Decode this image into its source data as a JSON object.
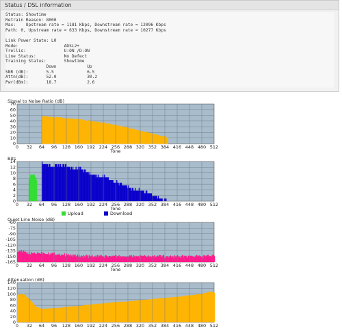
{
  "status": {
    "header": "Status / DSL information",
    "lines": [
      "Status: Showtime",
      "Retrain Reason: 8000",
      "Max:    Upstream rate = 1181 Kbps, Downstream rate = 12096 Kbps",
      "Path: 0, Upstream rate = 633 Kbps, Downstream rate = 10277 Kbps",
      "",
      "Link Power State: L0",
      "Mode:                  ADSL2+",
      "Trellis:               U:ON /D:ON",
      "Line Status:           No Defect",
      "Training Status:       Showtime",
      "                Down            Up",
      "SNR (dB):       5.5             6.5",
      "Attn(dB):       52.0            30.2",
      "Pwr(dBm):       18.7            2.6"
    ]
  },
  "colors": {
    "plot_bg": "#a8bccb",
    "grid": "#6f7d89",
    "snr": "#ffb400",
    "upload": "#33dd33",
    "download": "#0a00cc",
    "noise": "#ff1a8c",
    "attn": "#ffb400"
  },
  "chart_data": [
    {
      "type": "area",
      "title": "Signal to Noise Ratio (dB)",
      "xlabel": "Tone",
      "xlim": [
        0,
        512
      ],
      "ylim": [
        0,
        70
      ],
      "xticks": [
        "0",
        "32",
        "64",
        "96",
        "128",
        "160",
        "192",
        "224",
        "256",
        "288",
        "320",
        "352",
        "384",
        "416",
        "448",
        "480",
        "512"
      ],
      "yticks": [
        "70",
        "60",
        "50",
        "40",
        "30",
        "20",
        "10",
        "0"
      ],
      "series": [
        {
          "values": [
            [
              64,
              49
            ],
            [
              96,
              48
            ],
            [
              128,
              46
            ],
            [
              160,
              44
            ],
            [
              192,
              41
            ],
            [
              224,
              38
            ],
            [
              256,
              34
            ],
            [
              288,
              29
            ],
            [
              320,
              24
            ],
            [
              352,
              19
            ],
            [
              384,
              13
            ],
            [
              390,
              12
            ]
          ]
        }
      ]
    },
    {
      "type": "bar",
      "title": "Bits",
      "xlabel": "Tone",
      "xlim": [
        0,
        512
      ],
      "ylim": [
        0,
        15
      ],
      "xticks": [
        "0",
        "32",
        "64",
        "96",
        "128",
        "160",
        "192",
        "224",
        "256",
        "288",
        "320",
        "352",
        "384",
        "416",
        "448",
        "480",
        "512"
      ],
      "yticks": [
        "14",
        "12",
        "10",
        "8",
        "6",
        "4",
        "2",
        "0"
      ],
      "legend": [
        "Upload",
        "Download"
      ],
      "series": [
        {
          "name": "Upload",
          "values": [
            [
              30,
              8
            ],
            [
              32,
              9
            ],
            [
              35,
              10
            ],
            [
              38,
              10
            ],
            [
              42,
              10
            ],
            [
              46,
              9
            ],
            [
              50,
              8
            ]
          ]
        },
        {
          "name": "Download",
          "values": [
            [
              64,
              15
            ],
            [
              80,
              14
            ],
            [
              96,
              14
            ],
            [
              112,
              14
            ],
            [
              128,
              14
            ],
            [
              144,
              13
            ],
            [
              160,
              13
            ],
            [
              176,
              12
            ],
            [
              192,
              11
            ],
            [
              208,
              10
            ],
            [
              224,
              10
            ],
            [
              240,
              9
            ],
            [
              256,
              8
            ],
            [
              272,
              7
            ],
            [
              288,
              6
            ],
            [
              304,
              5
            ],
            [
              320,
              5
            ],
            [
              336,
              4
            ],
            [
              352,
              3
            ],
            [
              368,
              2
            ],
            [
              384,
              1
            ],
            [
              390,
              1
            ]
          ]
        }
      ]
    },
    {
      "type": "area",
      "title": "Quiet Line Noise (dB)",
      "xlabel": "Tone",
      "xlim": [
        0,
        512
      ],
      "ylim": [
        -165,
        -60
      ],
      "xticks": [
        "0",
        "32",
        "64",
        "96",
        "128",
        "160",
        "192",
        "224",
        "256",
        "288",
        "320",
        "352",
        "384",
        "416",
        "448",
        "480",
        "512"
      ],
      "yticks": [
        "-60",
        "-75",
        "-90",
        "-105",
        "-120",
        "-135",
        "-150",
        "-165"
      ],
      "series": [
        {
          "values": [
            [
              0,
              -134
            ],
            [
              32,
              -142
            ],
            [
              64,
              -140
            ],
            [
              96,
              -143
            ],
            [
              128,
              -146
            ],
            [
              160,
              -149
            ],
            [
              192,
              -150
            ],
            [
              224,
              -150
            ],
            [
              256,
              -150
            ],
            [
              288,
              -150
            ],
            [
              320,
              -150
            ],
            [
              352,
              -150
            ],
            [
              384,
              -150
            ],
            [
              416,
              -150
            ],
            [
              448,
              -150
            ],
            [
              480,
              -150
            ],
            [
              512,
              -149
            ]
          ]
        }
      ]
    },
    {
      "type": "area",
      "title": "Attenuation (dB)",
      "xlabel": "Tone",
      "xlim": [
        0,
        512
      ],
      "ylim": [
        0,
        140
      ],
      "xticks": [
        "0",
        "32",
        "64",
        "96",
        "128",
        "160",
        "192",
        "224",
        "256",
        "288",
        "320",
        "352",
        "384",
        "416",
        "448",
        "480",
        "512"
      ],
      "yticks": [
        "140",
        "120",
        "100",
        "80",
        "60",
        "40",
        "20",
        "0"
      ],
      "series": [
        {
          "values": [
            [
              0,
              98
            ],
            [
              16,
              100
            ],
            [
              32,
              80
            ],
            [
              48,
              55
            ],
            [
              64,
              48
            ],
            [
              96,
              50
            ],
            [
              128,
              54
            ],
            [
              160,
              58
            ],
            [
              192,
              63
            ],
            [
              224,
              67
            ],
            [
              256,
              71
            ],
            [
              288,
              74
            ],
            [
              320,
              78
            ],
            [
              352,
              82
            ],
            [
              384,
              86
            ],
            [
              416,
              90
            ],
            [
              448,
              95
            ],
            [
              480,
              100
            ],
            [
              500,
              108
            ],
            [
              512,
              104
            ]
          ]
        }
      ]
    }
  ]
}
